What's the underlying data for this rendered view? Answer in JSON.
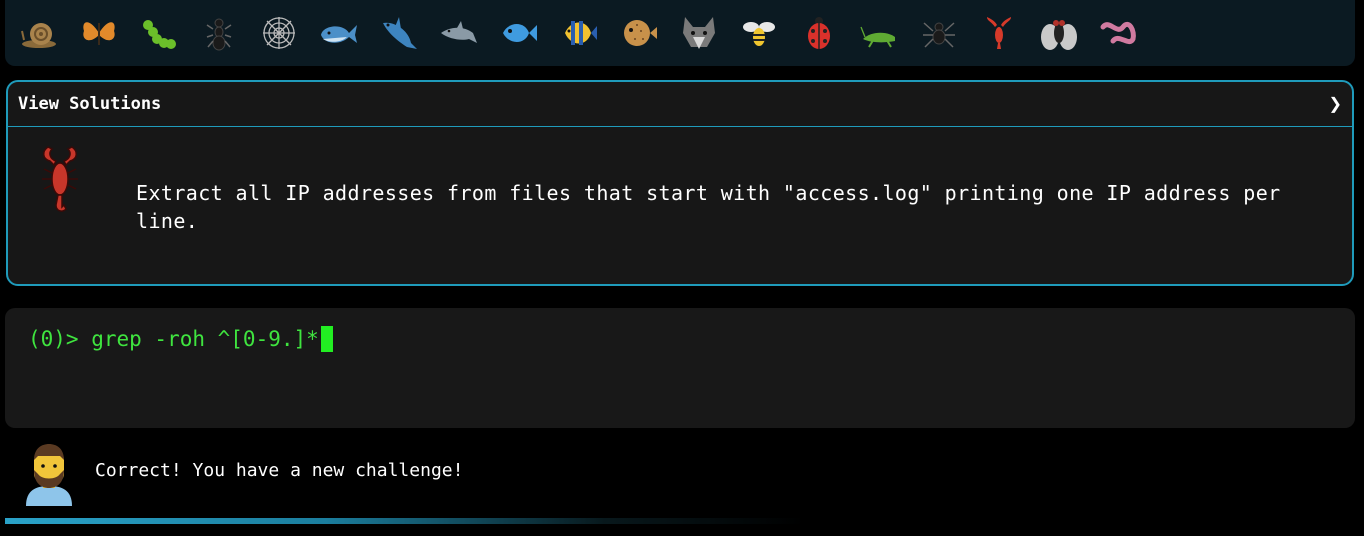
{
  "animals": [
    {
      "name": "snail"
    },
    {
      "name": "butterfly"
    },
    {
      "name": "caterpillar"
    },
    {
      "name": "ant"
    },
    {
      "name": "spider-web"
    },
    {
      "name": "whale"
    },
    {
      "name": "shark"
    },
    {
      "name": "dolphin"
    },
    {
      "name": "fish"
    },
    {
      "name": "tropical-fish"
    },
    {
      "name": "blowfish"
    },
    {
      "name": "wolf"
    },
    {
      "name": "bee"
    },
    {
      "name": "ladybug"
    },
    {
      "name": "cricket"
    },
    {
      "name": "spider"
    },
    {
      "name": "scorpion"
    },
    {
      "name": "fly"
    },
    {
      "name": "worm"
    }
  ],
  "panel": {
    "title": "View Solutions",
    "chevron": "❯",
    "challenge_icon": "scorpion",
    "challenge_text": "Extract all IP addresses from files that start with \"access.log\" printing one IP address per line."
  },
  "terminal": {
    "prompt": "(0)> ",
    "input": "grep -roh ^[0-9.]*"
  },
  "message": {
    "avatar": "man-avatar",
    "text": "Correct! You have a new challenge!"
  },
  "colors": {
    "accent": "#1f9bbb",
    "prompt_green": "#3fe43f",
    "cursor_green": "#22ee22",
    "panel_bg": "#171717"
  }
}
